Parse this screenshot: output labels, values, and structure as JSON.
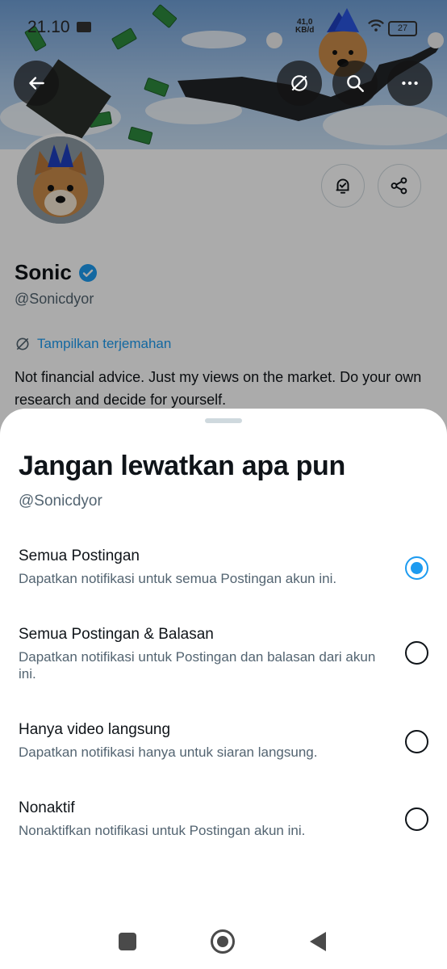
{
  "status_bar": {
    "time": "21.10",
    "net_speed_value": "41,0",
    "net_speed_unit": "KB/d",
    "battery": "27"
  },
  "profile": {
    "name": "Sonic",
    "handle": "@Sonicdyor",
    "translate_label": "Tampilkan terjemahan",
    "bio": "Not financial advice. Just my views on the market. Do your own research and decide for yourself."
  },
  "sheet": {
    "title": "Jangan lewatkan apa pun",
    "subtitle": "@Sonicdyor",
    "selected_index": 0,
    "options": [
      {
        "title": "Semua Postingan",
        "desc": "Dapatkan notifikasi untuk semua Postingan akun ini."
      },
      {
        "title": "Semua Postingan & Balasan",
        "desc": "Dapatkan notifikasi untuk Postingan dan balasan dari akun ini."
      },
      {
        "title": "Hanya video langsung",
        "desc": "Dapatkan notifikasi hanya untuk siaran langsung."
      },
      {
        "title": "Nonaktif",
        "desc": "Nonaktifkan notifikasi untuk Postingan akun ini."
      }
    ]
  },
  "icons": {
    "back": "arrow-left-icon",
    "translate": "translate-icon",
    "search": "search-icon",
    "more": "more-horizontal-icon",
    "notify": "bell-check-icon",
    "share": "share-icon",
    "verified": "verified-badge-icon"
  },
  "colors": {
    "accent": "#1d9bf0",
    "text": "#0f1419",
    "muted": "#536471"
  }
}
